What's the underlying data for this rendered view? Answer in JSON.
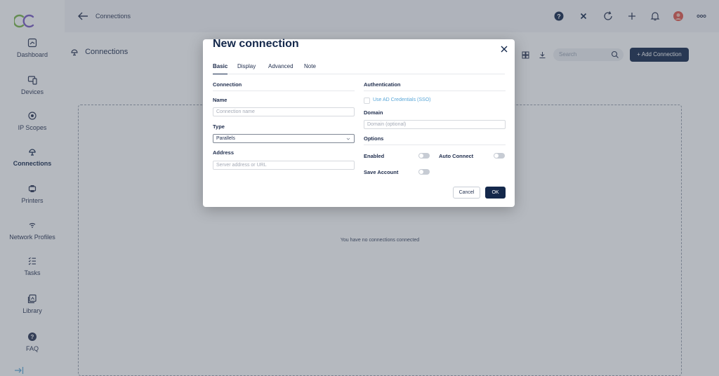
{
  "sidebar": {
    "items": [
      {
        "label": "Dashboard",
        "icon": "dashboard-icon"
      },
      {
        "label": "Devices",
        "icon": "devices-icon"
      },
      {
        "label": "IP Scopes",
        "icon": "ip-scopes-icon"
      },
      {
        "label": "Connections",
        "icon": "connections-icon",
        "active": true
      },
      {
        "label": "Printers",
        "icon": "printer-icon"
      },
      {
        "label": "Network Profiles",
        "icon": "wifi-icon"
      },
      {
        "label": "Tasks",
        "icon": "tasks-icon"
      },
      {
        "label": "Library",
        "icon": "library-icon"
      },
      {
        "label": "FAQ",
        "icon": "help-icon"
      }
    ]
  },
  "topbar": {
    "title": "Connections",
    "icons": [
      "help-icon",
      "close-x-icon",
      "refresh-icon",
      "plus-icon",
      "bell-icon",
      "avatar",
      "more-icon"
    ]
  },
  "main": {
    "page_title": "Connections",
    "search_placeholder": "Search",
    "add_button": "+ Add Connection",
    "empty_message": "You have no connections connected"
  },
  "modal": {
    "title": "New connection",
    "tabs": [
      "Basic",
      "Display",
      "Advanced",
      "Note"
    ],
    "active_tab": "Basic",
    "connection": {
      "heading": "Connection",
      "name_label": "Name",
      "name_placeholder": "Connection name",
      "type_label": "Type",
      "type_value": "Parallels",
      "address_label": "Address",
      "address_placeholder": "Server address or URL"
    },
    "authentication": {
      "heading": "Authentication",
      "sso_label": "Use AD Credentials (SSO)",
      "domain_label": "Domain",
      "domain_placeholder": "Domain (optional)"
    },
    "options": {
      "heading": "Options",
      "enabled_label": "Enabled",
      "auto_connect_label": "Auto Connect",
      "save_account_label": "Save Account",
      "enabled": false,
      "auto_connect": false,
      "save_account": false
    },
    "cancel_label": "Cancel",
    "ok_label": "OK"
  },
  "colors": {
    "primary": "#14284b",
    "link": "#5aa7d8",
    "logo_green": "#7ab648",
    "logo_purple": "#7b5cc4",
    "help_icon": "#14284b",
    "avatar": "#e2574c"
  }
}
